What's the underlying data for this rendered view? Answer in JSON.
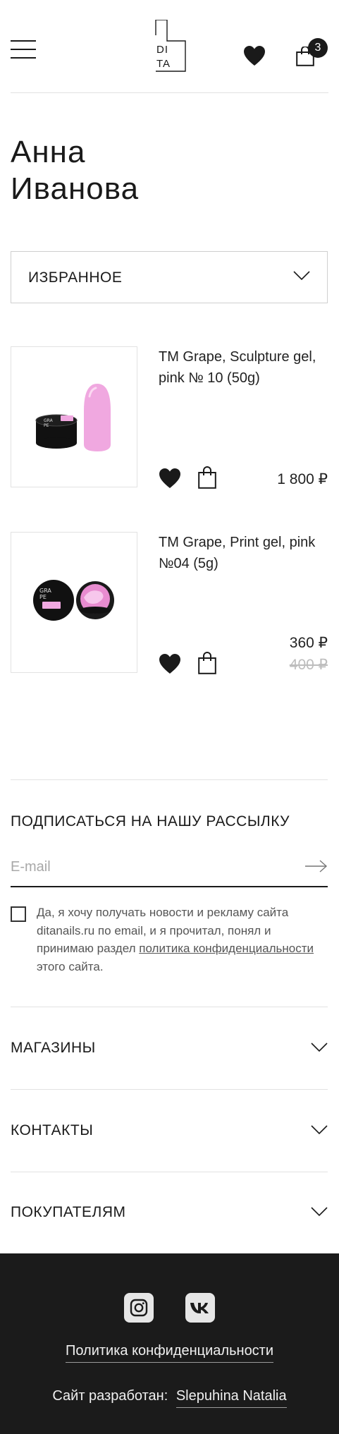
{
  "header": {
    "logo_line1": "DI",
    "logo_line2": "TA",
    "cart_count": "3",
    "icons": [
      "menu-icon",
      "heart-icon",
      "shopping-bag-icon"
    ]
  },
  "profile": {
    "first_name": "Анна",
    "last_name": "Иванова"
  },
  "section_dropdown": {
    "selected": "ИЗБРАННОЕ"
  },
  "products": [
    {
      "title": "TM Grape, Sculpture gel, pink № 10 (50g)",
      "price": "1 800 ₽"
    },
    {
      "title": "TM Grape, Print gel, pink №04 (5g)",
      "price": "360 ₽",
      "old_price": "400 ₽"
    }
  ],
  "subscribe": {
    "title": "ПОДПИСАТЬСЯ НА НАШУ РАССЫЛКУ",
    "email_placeholder": "E-mail",
    "consent_before": "Да, я хочу получать новости и рекламу сайта ditanails.ru по email, и я прочитал, понял и принимаю раздел ",
    "consent_link": "политика конфиденциальности",
    "consent_after": " этого сайта."
  },
  "accordion": {
    "stores": "МАГАЗИНЫ",
    "contacts": "КОНТАКТЫ",
    "customers": "ПОКУПАТЕЛЯМ"
  },
  "footer": {
    "privacy_link": "Политика конфиденциальности",
    "developer_label": "Сайт разработан:",
    "developer_name": "Slepuhina Natalia",
    "social_icons": [
      "instagram-icon",
      "vk-icon"
    ]
  },
  "colors": {
    "text": "#1a1a1a",
    "border": "#cfcfcf",
    "divider": "#e2e2e2",
    "old_price": "#bdbdbd",
    "footer_bg": "#1b1b1b",
    "product_pink": "#f0a8e0"
  }
}
